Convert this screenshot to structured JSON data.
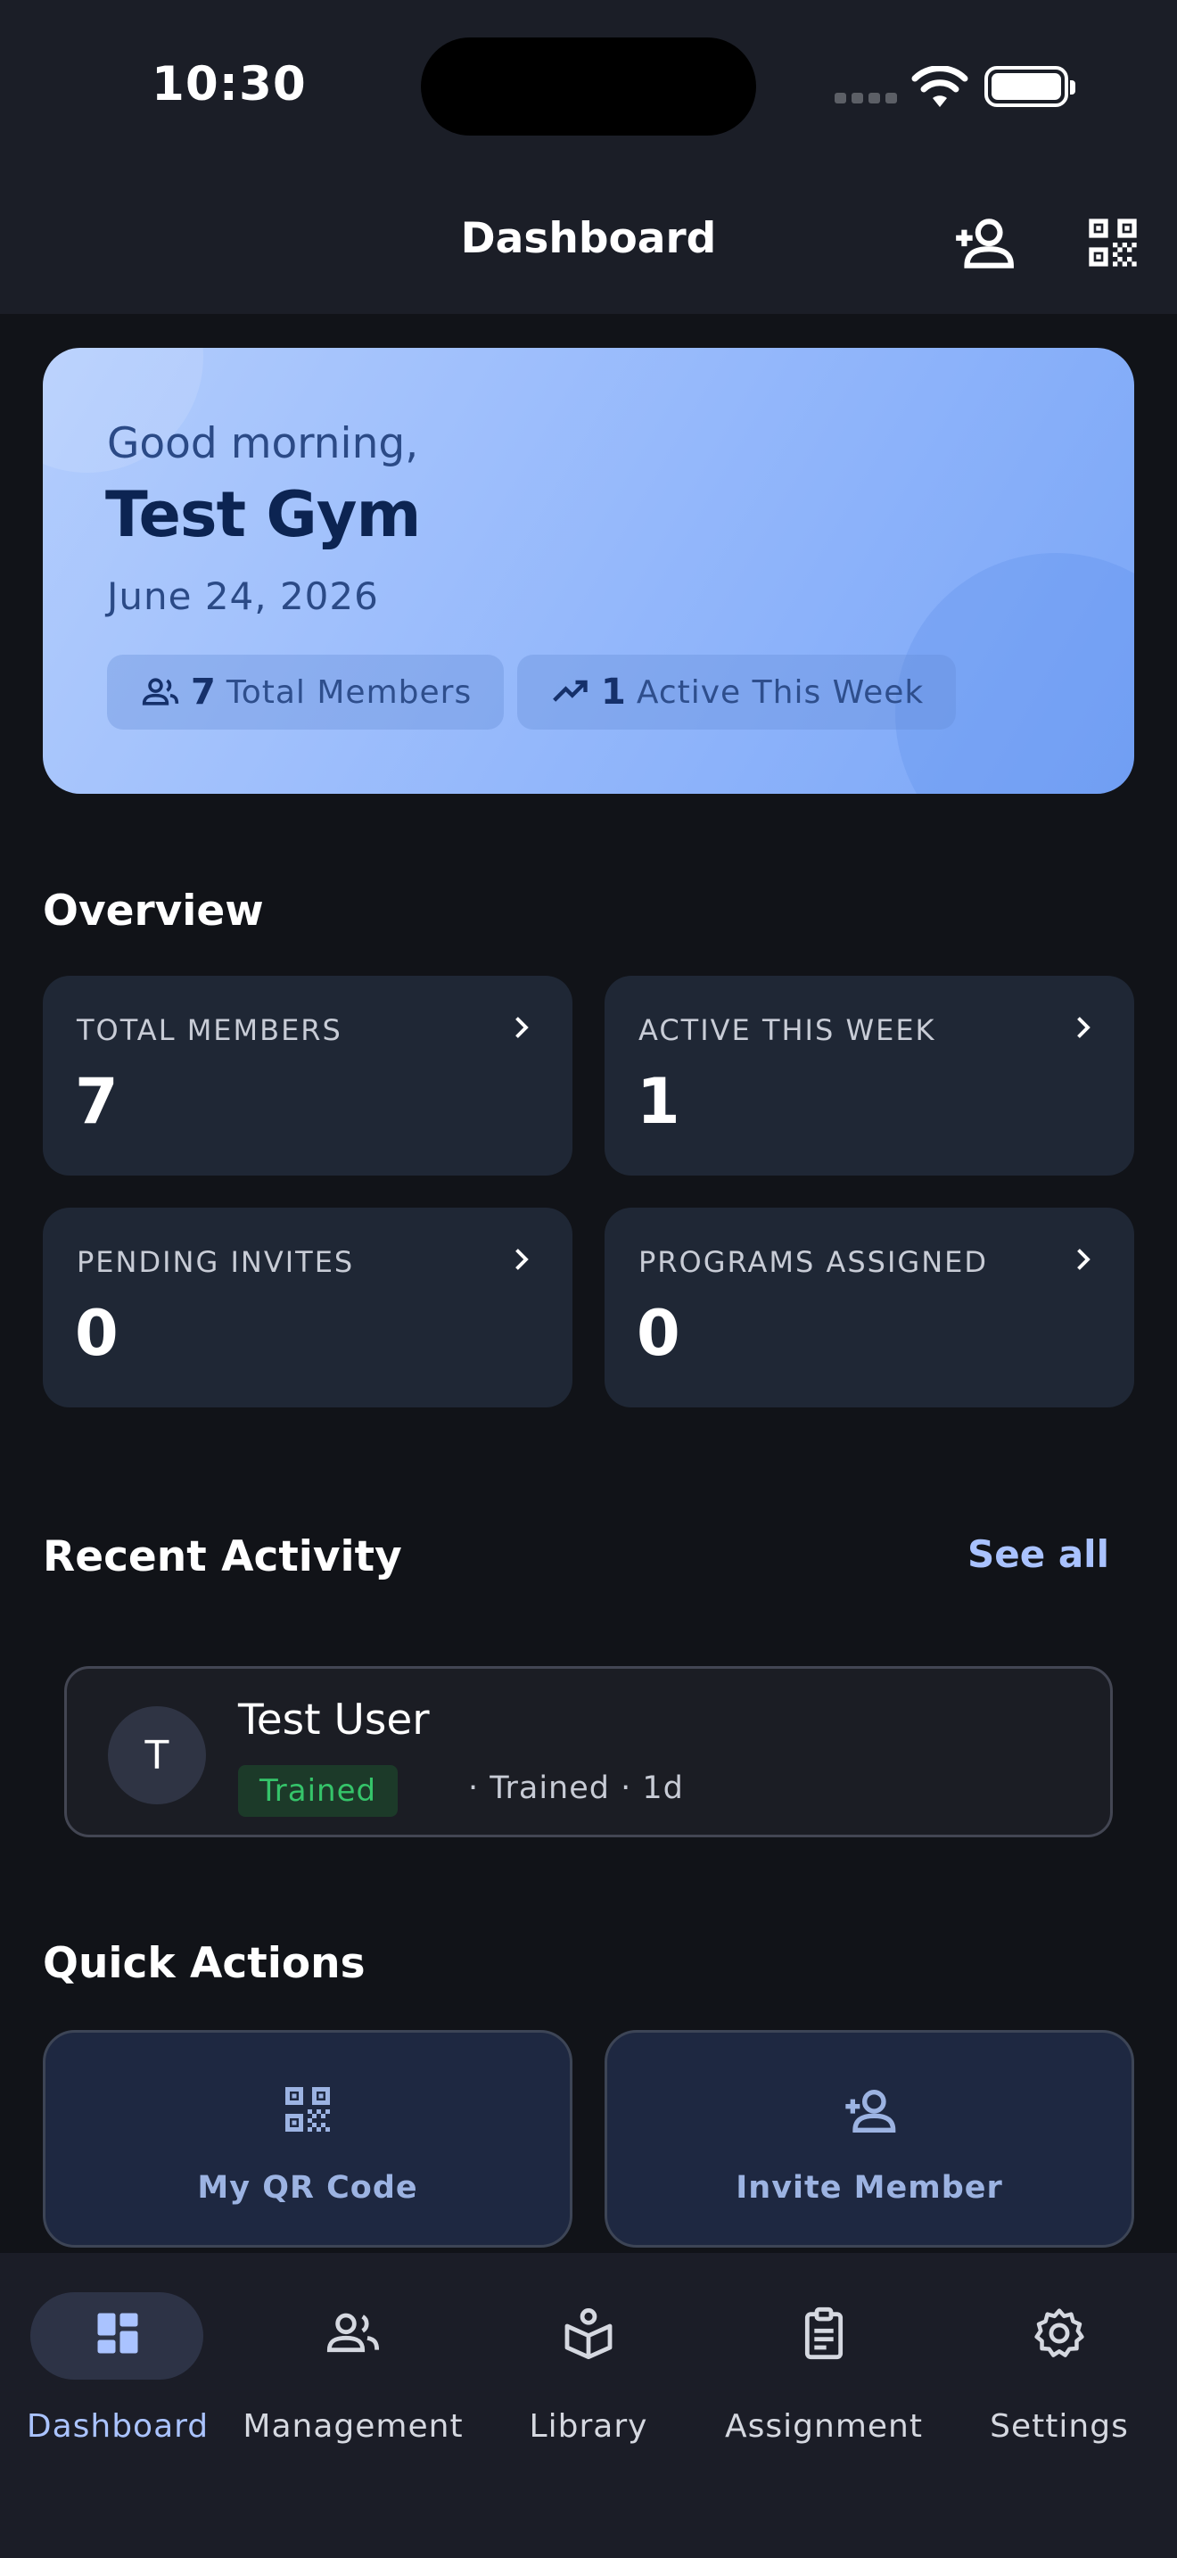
{
  "status_bar": {
    "time": "10:30"
  },
  "app_bar": {
    "title": "Dashboard",
    "icons": [
      "add-person-icon",
      "qr-code-icon"
    ]
  },
  "hero": {
    "greeting": "Good morning,",
    "gym_name": "Test Gym",
    "date": "June 24, 2026",
    "pills": [
      {
        "icon": "people-icon",
        "value": "7",
        "label": "Total Members"
      },
      {
        "icon": "trending-up-icon",
        "value": "1",
        "label": "Active This Week"
      }
    ]
  },
  "overview": {
    "title": "Overview",
    "cards": [
      {
        "label": "TOTAL MEMBERS",
        "value": "7"
      },
      {
        "label": "ACTIVE THIS WEEK",
        "value": "1"
      },
      {
        "label": "PENDING INVITES",
        "value": "0"
      },
      {
        "label": "PROGRAMS ASSIGNED",
        "value": "0"
      }
    ]
  },
  "recent_activity": {
    "title": "Recent Activity",
    "see_all": "See all",
    "items": [
      {
        "initial": "T",
        "name": "Test User",
        "badge": "Trained",
        "meta": "· Trained · 1d"
      }
    ]
  },
  "quick_actions": {
    "title": "Quick Actions",
    "items": [
      {
        "icon": "qr-code-icon",
        "label": "My QR Code"
      },
      {
        "icon": "add-person-icon",
        "label": "Invite Member"
      }
    ]
  },
  "bottom_nav": {
    "active": "Dashboard",
    "items": [
      {
        "icon": "dashboard-icon",
        "label": "Dashboard"
      },
      {
        "icon": "people-icon",
        "label": "Management"
      },
      {
        "icon": "library-icon",
        "label": "Library"
      },
      {
        "icon": "clipboard-icon",
        "label": "Assignment"
      },
      {
        "icon": "gear-icon",
        "label": "Settings"
      }
    ]
  },
  "colors": {
    "background": "#111318",
    "surface": "#1f2735",
    "accent": "#aac3ff",
    "badge_green": "#35c46a"
  }
}
